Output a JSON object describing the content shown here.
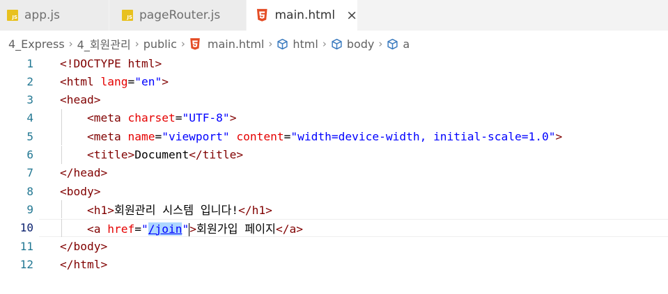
{
  "tabs": [
    {
      "label": "app.js",
      "icon": "javascript-file-icon",
      "icon_text": "JS",
      "active": false
    },
    {
      "label": "pageRouter.js",
      "icon": "javascript-file-icon",
      "icon_text": "JS",
      "active": false
    },
    {
      "label": "main.html",
      "icon": "html5-file-icon",
      "active": true,
      "close_symbol": "×"
    }
  ],
  "breadcrumb": {
    "items": [
      "4_Express",
      "4_회원관리",
      "public",
      "main.html",
      "html",
      "body",
      "a"
    ],
    "separator": "›"
  },
  "editor": {
    "current_line": 10,
    "line_numbers": [
      "1",
      "2",
      "3",
      "4",
      "5",
      "6",
      "7",
      "8",
      "9",
      "10",
      "11",
      "12"
    ],
    "lines": [
      [
        [
          "tag",
          "<!DOCTYPE html>"
        ]
      ],
      [
        [
          "tag",
          "<html "
        ],
        [
          "attr",
          "lang"
        ],
        [
          "punc",
          "="
        ],
        [
          "val",
          "\"en\""
        ],
        [
          "tag",
          ">"
        ]
      ],
      [
        [
          "tag",
          "<head>"
        ]
      ],
      [
        [
          "text",
          "    "
        ],
        [
          "tag",
          "<meta "
        ],
        [
          "attr",
          "charset"
        ],
        [
          "punc",
          "="
        ],
        [
          "val",
          "\"UTF-8\""
        ],
        [
          "tag",
          ">"
        ]
      ],
      [
        [
          "text",
          "    "
        ],
        [
          "tag",
          "<meta "
        ],
        [
          "attr",
          "name"
        ],
        [
          "punc",
          "="
        ],
        [
          "val",
          "\"viewport\""
        ],
        [
          "text",
          " "
        ],
        [
          "attr",
          "content"
        ],
        [
          "punc",
          "="
        ],
        [
          "val",
          "\"width=device-width, initial-scale=1.0\""
        ],
        [
          "tag",
          ">"
        ]
      ],
      [
        [
          "text",
          "    "
        ],
        [
          "tag",
          "<title>"
        ],
        [
          "text",
          "Document"
        ],
        [
          "tag",
          "</title>"
        ]
      ],
      [
        [
          "tag",
          "</head>"
        ]
      ],
      [
        [
          "tag",
          "<body>"
        ]
      ],
      [
        [
          "text",
          "    "
        ],
        [
          "tag",
          "<h1>"
        ],
        [
          "text",
          "회원관리 시스템 입니다!"
        ],
        [
          "tag",
          "</h1>"
        ]
      ],
      [
        [
          "text",
          "    "
        ],
        [
          "tag",
          "<a "
        ],
        [
          "attr",
          "href"
        ],
        [
          "punc",
          "="
        ],
        [
          "val",
          "\""
        ],
        [
          "sel",
          "/join"
        ],
        [
          "val",
          "\""
        ],
        [
          "cursor",
          ""
        ],
        [
          "tag",
          ">"
        ],
        [
          "text",
          "회원가입 페이지"
        ],
        [
          "tag",
          "</a>"
        ]
      ],
      [
        [
          "tag",
          "</body>"
        ]
      ],
      [
        [
          "tag",
          "</html>"
        ]
      ]
    ]
  },
  "colors": {
    "tag": "#800000",
    "attr": "#e50000",
    "value": "#0000ff",
    "text": "#000000",
    "line_number": "#237893",
    "selection": "#add6ff",
    "js_icon": "#e8c11f",
    "html_icon": "#e44d26",
    "cube_icon": "#3b7bbf"
  }
}
